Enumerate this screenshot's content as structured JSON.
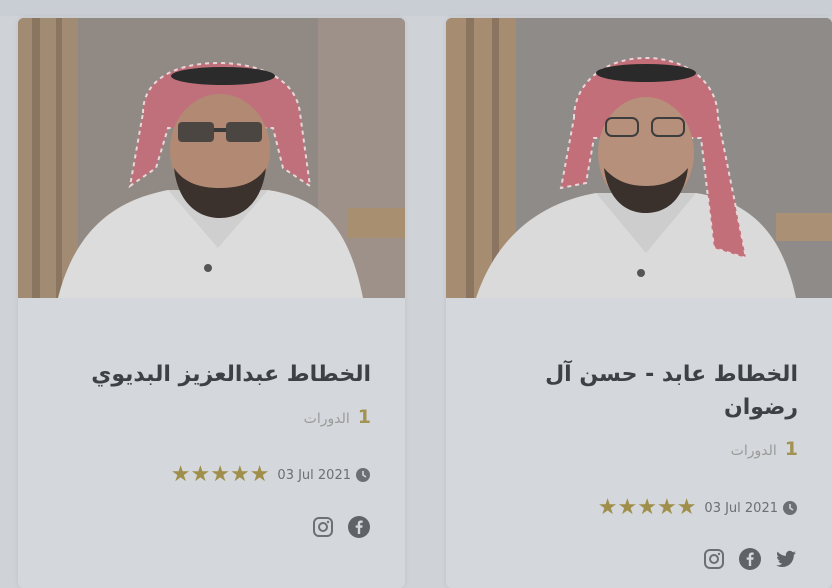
{
  "cards": [
    {
      "name_line1": "الخطاط عبدالعزيز البديوي",
      "name_line2": "",
      "courses_count": "1",
      "courses_label": "الدورات",
      "date": "03 Jul 2021",
      "rating": 5,
      "stars": "★★★★★",
      "social": [
        "facebook-icon",
        "instagram-icon"
      ]
    },
    {
      "name_line1": "الخطاط عابد - حسن آل",
      "name_line2": "رضوان",
      "courses_count": "1",
      "courses_label": "الدورات",
      "date": "03 Jul 2021",
      "rating": 5,
      "stars": "★★★★★",
      "social": [
        "twitter-icon",
        "facebook-icon",
        "instagram-icon"
      ]
    }
  ],
  "colors": {
    "page_bg": "#cfd3d8",
    "star": "#a08f4b",
    "title": "#3d4045",
    "muted": "#9a9a97",
    "accent_number": "#a39352"
  }
}
